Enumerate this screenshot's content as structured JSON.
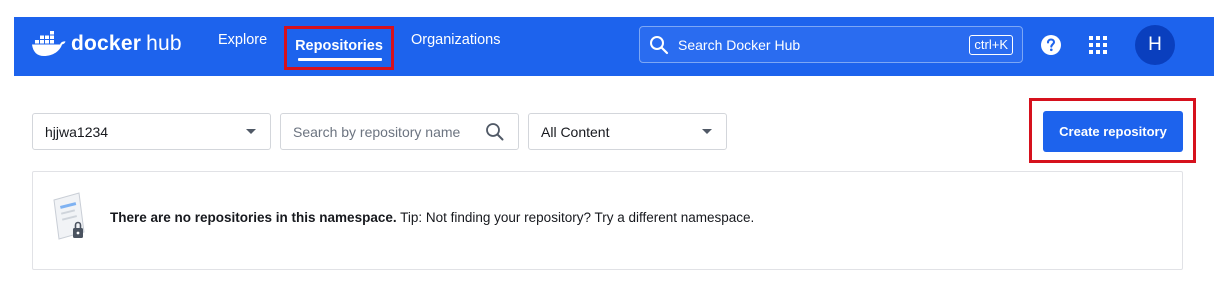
{
  "nav": {
    "logo_word1": "docker",
    "logo_word2": "hub",
    "links": {
      "explore": "Explore",
      "repositories": "Repositories",
      "organizations": "Organizations"
    },
    "search_placeholder": "Search Docker Hub",
    "search_shortcut": "ctrl+K",
    "avatar_initial": "H",
    "icons": {
      "logo": "docker-whale-icon",
      "search": "search-icon",
      "help": "help-icon",
      "apps": "apps-grid-icon"
    }
  },
  "toolbar": {
    "namespace_value": "hjjwa1234",
    "repo_search_placeholder": "Search by repository name",
    "content_filter_value": "All Content",
    "create_button_label": "Create repository"
  },
  "empty_state": {
    "bold_text": "There are no repositories in this namespace.",
    "tip_text": " Tip: Not finding your repository? Try a different namespace."
  },
  "colors": {
    "nav_bg": "#1d63ed",
    "primary_button": "#1d63ed",
    "highlight_box": "#d6111d",
    "avatar_bg": "#0a3fbe"
  }
}
